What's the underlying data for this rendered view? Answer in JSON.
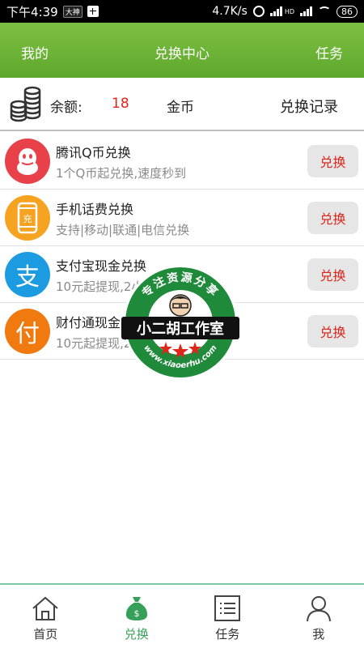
{
  "status_bar": {
    "time": "下午4:39",
    "app_badge": "大神",
    "net_speed": "4.7K/s",
    "battery": "86",
    "hd_label": "HD"
  },
  "header": {
    "left": "我的",
    "title": "兑换中心",
    "right": "任务"
  },
  "balance": {
    "label": "余额:",
    "value": "18",
    "unit": "金币",
    "record_link": "兑换记录"
  },
  "items": [
    {
      "title": "腾讯Q币兑换",
      "subtitle": "1个Q币起兑换,速度秒到",
      "button": "兑换",
      "icon": "penguin-icon",
      "icon_color": "#e8414a"
    },
    {
      "title": "手机话费兑换",
      "subtitle": "支持|移动|联通|电信兑换",
      "button": "兑换",
      "icon": "phone-recharge-icon",
      "icon_color": "#f5a321",
      "icon_text": "充"
    },
    {
      "title": "支付宝现金兑换",
      "subtitle": "10元起提现,2小时内到账",
      "button": "兑换",
      "icon": "alipay-icon",
      "icon_color": "#1d9be0",
      "icon_text": "支"
    },
    {
      "title": "财付通现金兑换",
      "subtitle": "10元起提现,2小时内到账",
      "button": "兑换",
      "icon": "tenpay-icon",
      "icon_color": "#f07a10",
      "icon_text": "付"
    }
  ],
  "watermark": {
    "top_text": "专注资源分享",
    "center_text": "小二胡工作室",
    "bottom_text": "www.xiaoerhu.com"
  },
  "bottom_nav": [
    {
      "label": "首页",
      "icon": "home-icon",
      "active": false
    },
    {
      "label": "兑换",
      "icon": "money-bag-icon",
      "active": true
    },
    {
      "label": "任务",
      "icon": "task-list-icon",
      "active": false
    },
    {
      "label": "我",
      "icon": "user-icon",
      "active": false
    }
  ],
  "colors": {
    "header_green": "#6ab536",
    "accent_red": "#d9261c",
    "nav_active": "#3aa05a"
  }
}
